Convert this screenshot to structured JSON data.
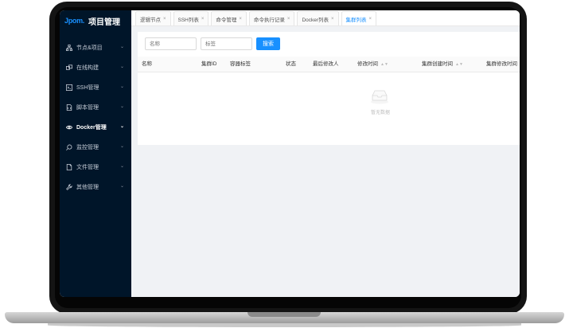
{
  "app": {
    "logo_mark": "Jpom.",
    "title": "项目管理"
  },
  "sidebar": {
    "items": [
      {
        "label": "节点&项目",
        "icon": "cluster-icon",
        "active": false
      },
      {
        "label": "在线构建",
        "icon": "build-icon",
        "active": false
      },
      {
        "label": "SSH管理",
        "icon": "terminal-icon",
        "active": false
      },
      {
        "label": "脚本管理",
        "icon": "file-code-icon",
        "active": false
      },
      {
        "label": "Docker管理",
        "icon": "docker-icon",
        "active": true
      },
      {
        "label": "监控管理",
        "icon": "monitor-icon",
        "active": false
      },
      {
        "label": "文件管理",
        "icon": "file-icon",
        "active": false
      },
      {
        "label": "其他管理",
        "icon": "tool-icon",
        "active": false
      }
    ]
  },
  "tabs": [
    {
      "label": "逻辑节点"
    },
    {
      "label": "SSH列表"
    },
    {
      "label": "命令管理"
    },
    {
      "label": "命令执行记录"
    },
    {
      "label": "Docker列表"
    },
    {
      "label": "集群列表",
      "active": true
    }
  ],
  "filters": {
    "name_placeholder": "名称",
    "tag_placeholder": "标签",
    "search_label": "搜索"
  },
  "table": {
    "columns": [
      "名称",
      "集群ID",
      "容器标签",
      "状态",
      "最后修改人",
      "修改时间",
      "集群创建时间",
      "集群修改时间"
    ],
    "empty_text": "暂无数据"
  }
}
